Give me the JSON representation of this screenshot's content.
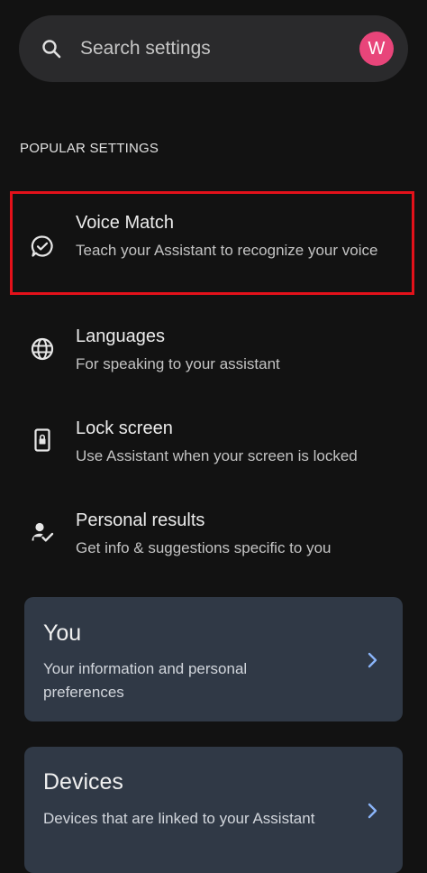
{
  "search": {
    "placeholder": "Search settings",
    "icon": "search-icon",
    "avatar_initial": "W",
    "avatar_color": "#e8457a"
  },
  "popular": {
    "section_title": "POPULAR SETTINGS",
    "items": [
      {
        "title": "Voice Match",
        "subtitle": "Teach your Assistant to recognize your voice",
        "icon": "voice-match-icon"
      },
      {
        "title": "Languages",
        "subtitle": "For speaking to your assistant",
        "icon": "globe-icon"
      },
      {
        "title": "Lock screen",
        "subtitle": "Use Assistant when your screen is locked",
        "icon": "lock-screen-icon"
      },
      {
        "title": "Personal results",
        "subtitle": "Get info & suggestions specific to you",
        "icon": "person-check-icon"
      }
    ]
  },
  "cards": [
    {
      "title": "You",
      "subtitle": "Your information and personal preferences",
      "icon": "chevron-right-icon"
    },
    {
      "title": "Devices",
      "subtitle": "Devices that are linked to your Assistant",
      "icon": "chevron-right-icon"
    }
  ],
  "colors": {
    "background": "#121212",
    "search_bar": "#2a2a2c",
    "card": "#303946",
    "accent": "#8ab4f8",
    "highlight": "#e3111a"
  }
}
